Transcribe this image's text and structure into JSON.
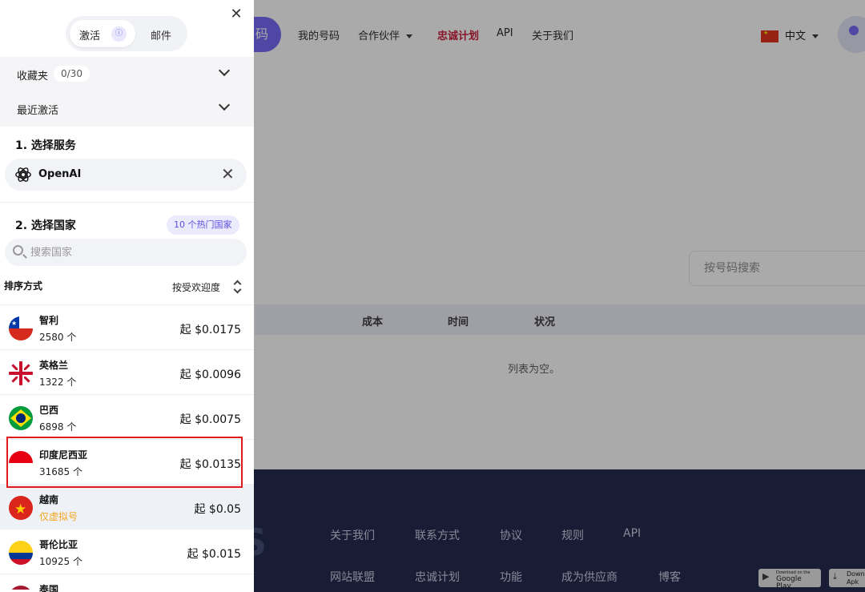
{
  "header": {
    "brand_fragment": "码",
    "nav": [
      "我的号码",
      "合作伙伴",
      "忠诚计划",
      "API",
      "关于我们"
    ],
    "language": "中文"
  },
  "main": {
    "search_placeholder": "按号码搜索",
    "table_headers": [
      "成本",
      "时间",
      "状况"
    ],
    "empty_text": "列表为空。"
  },
  "footer": {
    "logo_fragment": "S",
    "links_row1": [
      "关于我们",
      "联系方式",
      "协议",
      "规则",
      "API"
    ],
    "links_row2": [
      "网站联盟",
      "忠诚计划",
      "功能",
      "成为供应商",
      "博客"
    ],
    "google_play": {
      "small": "Download on the",
      "big": "Google Play"
    },
    "apk": {
      "small": "Down",
      "big": "Apk"
    }
  },
  "panel": {
    "close_icon": "close-icon",
    "tabs": {
      "activate": "激活",
      "mail": "邮件"
    },
    "favorites": {
      "label": "收藏夹",
      "count": "0/30"
    },
    "recent": {
      "label": "最近激活"
    },
    "step1": "1. 选择服务",
    "service": {
      "name": "OpenAI",
      "icon": "openai-icon"
    },
    "step2": "2. 选择国家",
    "hot_badge": "10 个热门国家",
    "search_placeholder": "搜索国家",
    "sort": {
      "label": "排序方式",
      "value": "按受欢迎度"
    },
    "countries": [
      {
        "name": "智利",
        "sub": "2580 个",
        "price": "起 $0.0175",
        "flag": "chile-flag-icon"
      },
      {
        "name": "英格兰",
        "sub": "1322 个",
        "price": "起 $0.0096",
        "flag": "england-uk-flag-icon"
      },
      {
        "name": "巴西",
        "sub": "6898 个",
        "price": "起 $0.0075",
        "flag": "brazil-flag-icon"
      },
      {
        "name": "印度尼西亚",
        "sub": "31685 个",
        "price": "起 $0.0135",
        "flag": "indonesia-flag-icon"
      },
      {
        "name": "越南",
        "sub": "仅虚拟号",
        "price": "起 $0.05",
        "flag": "vietnam-flag-icon"
      },
      {
        "name": "哥伦比亚",
        "sub": "10925 个",
        "price": "起 $0.015",
        "flag": "colombia-flag-icon"
      },
      {
        "name": "泰国",
        "sub": "",
        "price": "",
        "flag": "thailand-flag-icon"
      }
    ]
  },
  "colors": {
    "accent": "#6f63f6",
    "active_nav": "#c8102e",
    "highlight_box": "#e11b1b",
    "footer_bg": "#181f45",
    "warning": "#f5a623"
  }
}
